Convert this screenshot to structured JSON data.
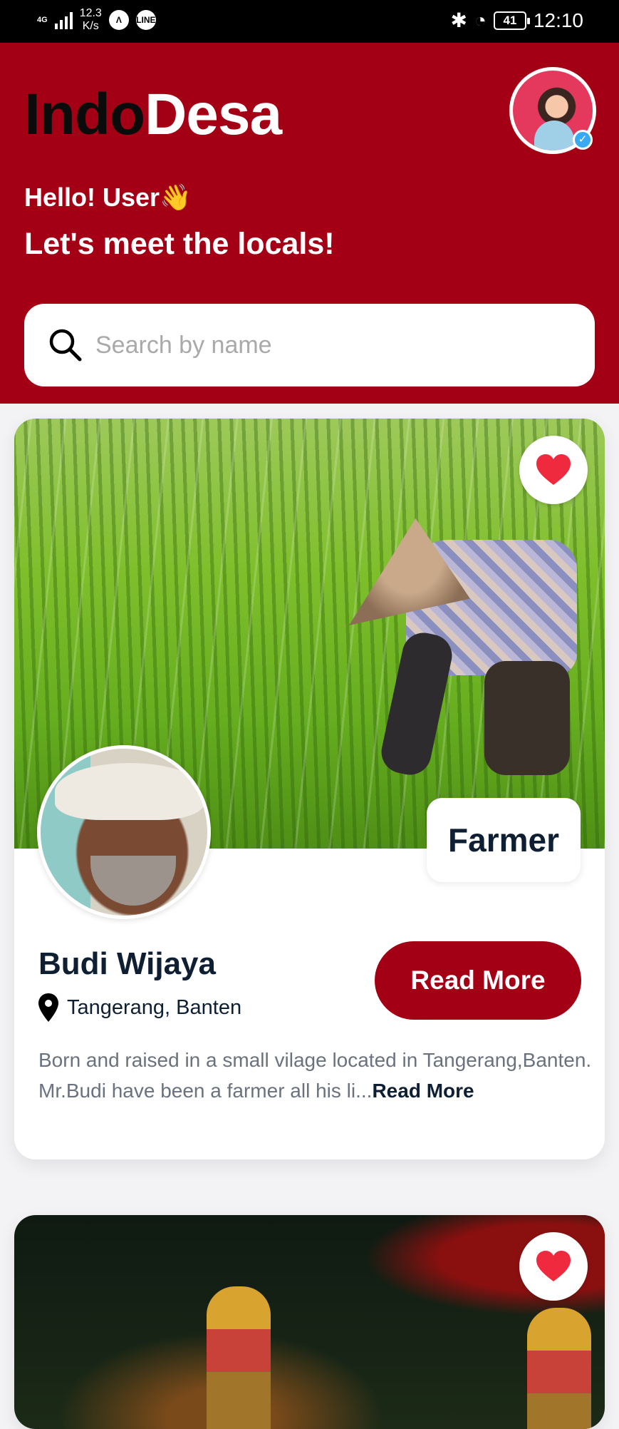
{
  "status_bar": {
    "network": "4G",
    "speed": "12.3",
    "speed_unit": "K/s",
    "battery": "41",
    "time": "12:10"
  },
  "header": {
    "logo_part1": "Indo",
    "logo_part2": "Desa",
    "greeting": "Hello! User👋",
    "subtitle": "Let's meet the locals!",
    "colors": {
      "primary": "#a30015",
      "logo_dark": "#0b0b0b"
    }
  },
  "search": {
    "placeholder": "Search by name"
  },
  "cards": [
    {
      "role": "Farmer",
      "name": "Budi Wijaya",
      "location": "Tangerang, Banten",
      "description": "Born and raised in a small vilage located in Tangerang,Banten. Mr.Budi have been a farmer all his li...",
      "inline_read_more": "Read More",
      "button_label": "Read More",
      "favorite_icon": "heart-icon"
    }
  ]
}
